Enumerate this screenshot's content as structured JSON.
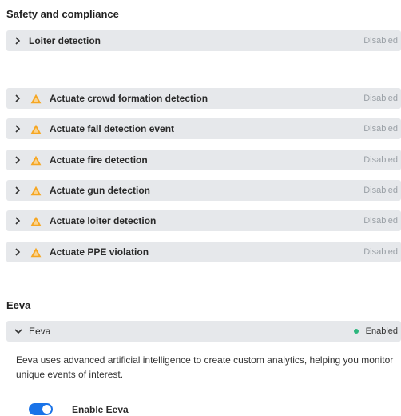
{
  "safety": {
    "title": "Safety and compliance",
    "loiter": {
      "label": "Loiter detection",
      "status": "Disabled"
    },
    "actuate_items": [
      {
        "label": "Actuate crowd formation detection",
        "status": "Disabled"
      },
      {
        "label": "Actuate fall detection event",
        "status": "Disabled"
      },
      {
        "label": "Actuate fire detection",
        "status": "Disabled"
      },
      {
        "label": "Actuate gun detection",
        "status": "Disabled"
      },
      {
        "label": "Actuate loiter detection",
        "status": "Disabled"
      },
      {
        "label": "Actuate PPE violation",
        "status": "Disabled"
      }
    ]
  },
  "eeva": {
    "title": "Eeva",
    "panel": {
      "label": "Eeva",
      "status": "Enabled",
      "status_color": "#2cb67d"
    },
    "description": "Eeva uses advanced artificial intelligence to create custom analytics, helping you monitor unique events of interest.",
    "toggle": {
      "label": "Enable Eeva",
      "on": true
    }
  },
  "colors": {
    "row_bg": "#e6e8eb",
    "warn_icon": "#f5a623",
    "toggle_on": "#1a73e8",
    "muted": "#9aa0a6"
  },
  "icons": {
    "collapsed": "chevron-right-icon",
    "expanded": "chevron-down-icon",
    "actuate": "warning-triangle-icon"
  }
}
